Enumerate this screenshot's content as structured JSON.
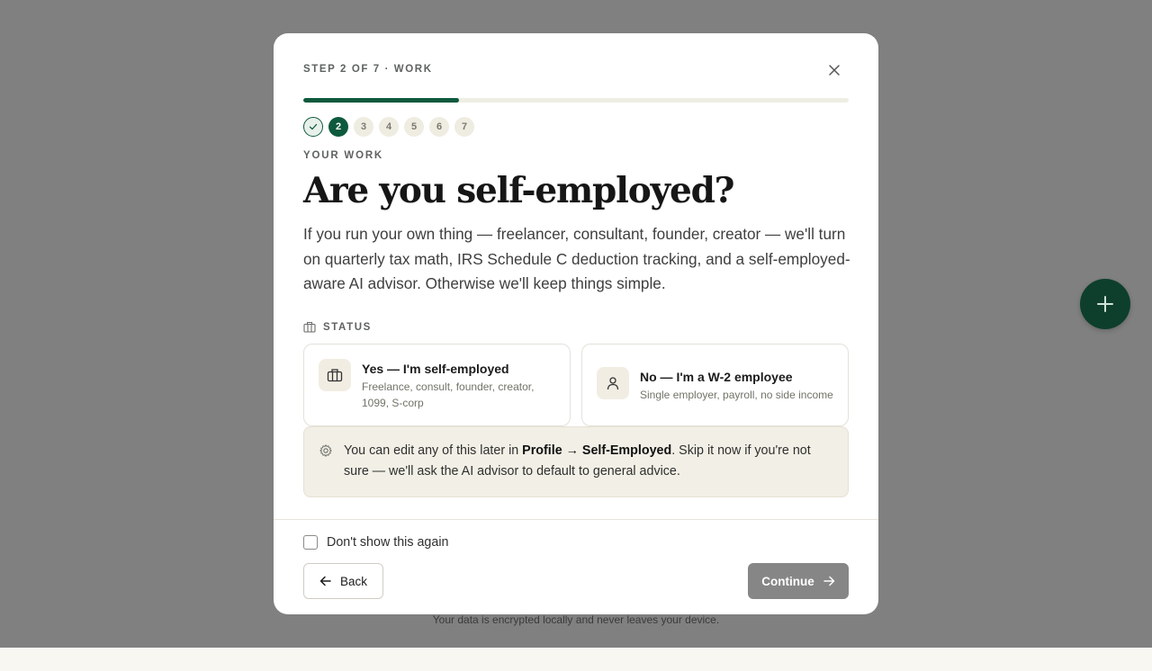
{
  "background": {
    "footer_note": "Your data is encrypted locally and never leaves your device."
  },
  "modal": {
    "step_label": "STEP 2 OF 7 · WORK",
    "progress": {
      "current": 2,
      "total": 7,
      "fill_fraction": 0.285
    },
    "steps": [
      {
        "label": "",
        "state": "done"
      },
      {
        "label": "2",
        "state": "active"
      },
      {
        "label": "3",
        "state": "pending"
      },
      {
        "label": "4",
        "state": "pending"
      },
      {
        "label": "5",
        "state": "pending"
      },
      {
        "label": "6",
        "state": "pending"
      },
      {
        "label": "7",
        "state": "pending"
      }
    ],
    "section_kicker": "YOUR WORK",
    "title": "Are you self-employed?",
    "description": "If you run your own thing — freelancer, consultant, founder, creator — we'll turn on quarterly tax math, IRS Schedule C deduction tracking, and a self-employed-aware AI advisor. Otherwise we'll keep things simple.",
    "status_label": "STATUS",
    "options": {
      "yes": {
        "title": "Yes — I'm self-employed",
        "subtitle": "Freelance, consult, founder, creator, 1099, S-corp",
        "icon": "briefcase-icon"
      },
      "no": {
        "title": "No — I'm a W-2 employee",
        "subtitle": "Single employer, payroll, no side income",
        "icon": "person-icon"
      }
    },
    "info": {
      "prefix": "You can edit any of this later in ",
      "bold": "Profile → Self-Employed",
      "suffix": ". Skip it now if you're not sure — we'll ask the AI advisor to default to general advice."
    },
    "dont_show_label": "Don't show this again",
    "back_label": "Back",
    "continue_label": "Continue"
  },
  "colors": {
    "accent": "#0e5a3e",
    "overlay": "#808080",
    "fab": "#0e3f2c",
    "continue_disabled": "#868686"
  }
}
